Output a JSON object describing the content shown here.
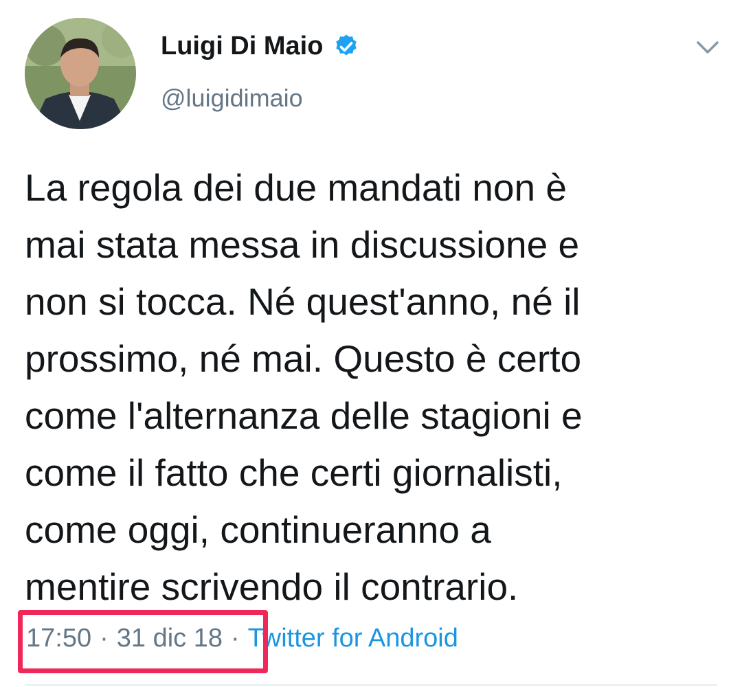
{
  "user": {
    "display_name": "Luigi Di Maio",
    "handle": "@luigidimaio",
    "verified": true
  },
  "tweet": {
    "text": "La regola dei due mandati non è\nmai stata messa in discussione e\nnon si tocca. Né quest'anno, né il\nprossimo, né mai. Questo è certo\ncome l'alternanza delle stagioni e\ncome il fatto che certi giornalisti,\ncome oggi, continueranno a\nmentire scrivendo il contrario.",
    "time": "17:50",
    "date": "31 dic 18",
    "separator": "·",
    "source": "Twitter for Android"
  },
  "icons": {
    "verified": "verified-badge-icon",
    "more": "chevron-down-icon"
  },
  "colors": {
    "text": "#14171a",
    "muted": "#657786",
    "link": "#1b95e0",
    "verified": "#1da1f2",
    "highlight": "#f0285a"
  }
}
